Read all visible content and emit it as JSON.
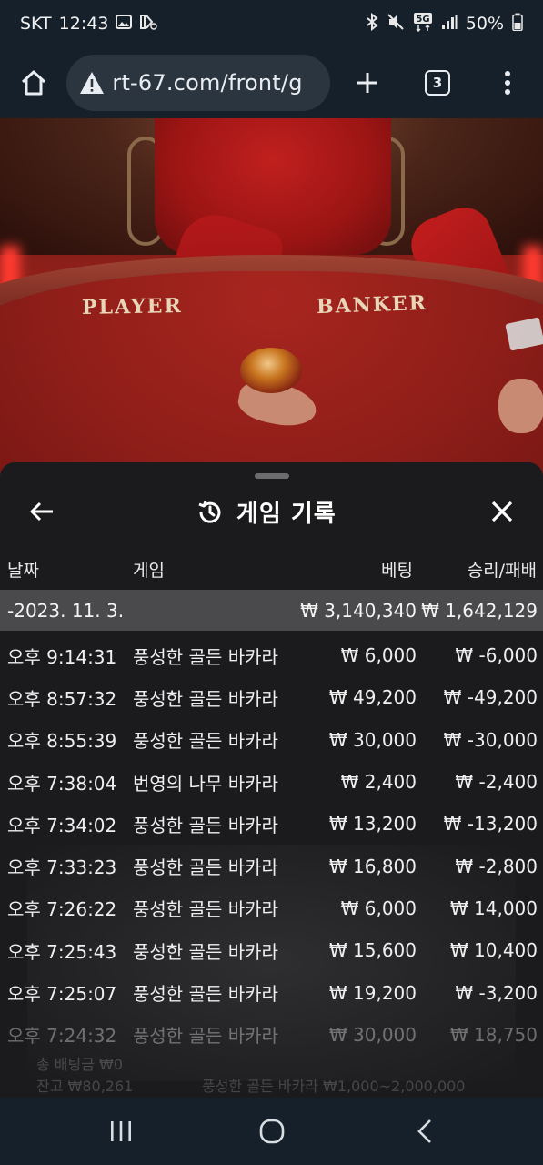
{
  "status_bar": {
    "carrier": "SKT",
    "time": "12:43",
    "battery": "50%",
    "network": "5G"
  },
  "browser": {
    "url": "rt-67.com/front/g",
    "tab_count": "3"
  },
  "video": {
    "player_label": "PLAYER",
    "banker_label": "BANKER"
  },
  "panel": {
    "title": "게임 기록",
    "columns": {
      "date": "날짜",
      "game": "게임",
      "bet": "베팅",
      "win_loss": "승리/패배"
    },
    "summary": {
      "date": "-2023. 11. 3.",
      "bet": "₩ 3,140,340",
      "win_loss": "₩ 1,642,129"
    },
    "rows": [
      {
        "time": "오후 9:14:31",
        "game": "풍성한 골든 바카라",
        "bet": "₩ 6,000",
        "win_loss": "₩ -6,000"
      },
      {
        "time": "오후 8:57:32",
        "game": "풍성한 골든 바카라",
        "bet": "₩ 49,200",
        "win_loss": "₩ -49,200"
      },
      {
        "time": "오후 8:55:39",
        "game": "풍성한 골든 바카라",
        "bet": "₩ 30,000",
        "win_loss": "₩ -30,000"
      },
      {
        "time": "오후 7:38:04",
        "game": "번영의 나무 바카라",
        "bet": "₩ 2,400",
        "win_loss": "₩ -2,400"
      },
      {
        "time": "오후 7:34:02",
        "game": "풍성한 골든 바카라",
        "bet": "₩ 13,200",
        "win_loss": "₩ -13,200"
      },
      {
        "time": "오후 7:33:23",
        "game": "풍성한 골든 바카라",
        "bet": "₩ 16,800",
        "win_loss": "₩ -2,800"
      },
      {
        "time": "오후 7:26:22",
        "game": "풍성한 골든 바카라",
        "bet": "₩ 6,000",
        "win_loss": "₩ 14,000"
      },
      {
        "time": "오후 7:25:43",
        "game": "풍성한 골든 바카라",
        "bet": "₩ 15,600",
        "win_loss": "₩ 10,400"
      },
      {
        "time": "오후 7:25:07",
        "game": "풍성한 골든 바카라",
        "bet": "₩ 19,200",
        "win_loss": "₩ -3,200"
      },
      {
        "time": "오후 7:24:32",
        "game": "풍성한 골든 바카라",
        "bet": "₩ 30,000",
        "win_loss": "₩ 18,750"
      }
    ],
    "background_ghost": {
      "total_bet": "총 배팅금 ₩0",
      "balance": "잔고 ₩80,261",
      "table_limit": "풍성한 골든 바카라 ₩1,000~2,000,000"
    }
  },
  "colors": {
    "panel_bg": "#1b1b1d",
    "summary_bg": "#4a4a4c",
    "chrome_bg": "#16202a"
  }
}
